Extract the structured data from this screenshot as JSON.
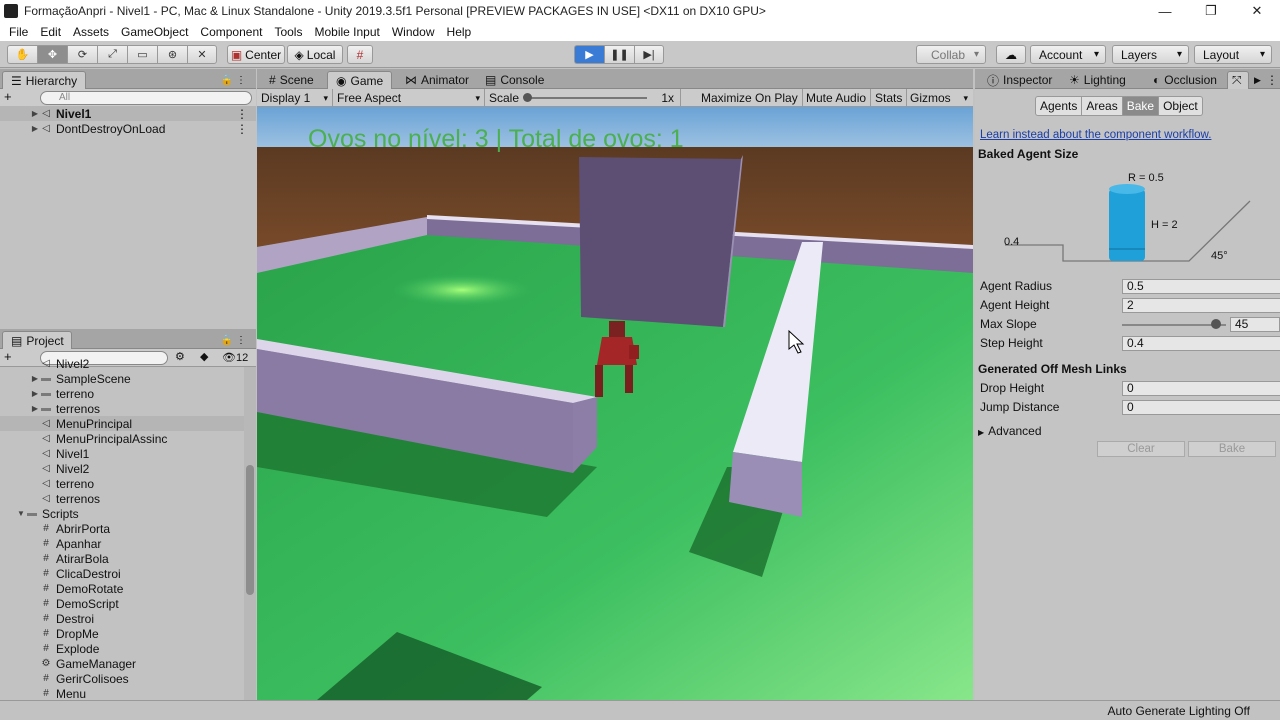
{
  "window": {
    "title": "FormaçãoAnpri - Nivel1 - PC, Mac & Linux Standalone - Unity 2019.3.5f1 Personal [PREVIEW PACKAGES IN USE] <DX11 on DX10 GPU>",
    "minimize": "—",
    "restore": "❐",
    "close": "✕"
  },
  "menu": [
    "File",
    "Edit",
    "Assets",
    "GameObject",
    "Component",
    "Tools",
    "Mobile Input",
    "Window",
    "Help"
  ],
  "toolbar": {
    "tools": [
      "✋",
      "✥",
      "⟳",
      "⤢",
      "▭",
      "⊛",
      "✕"
    ],
    "center": "Center",
    "local": "Local",
    "play": "▶",
    "pause": "❚❚",
    "step": "▶|",
    "collab": "Collab",
    "cloud": "☁",
    "account": "Account",
    "layers": "Layers",
    "layout": "Layout"
  },
  "hierarchy": {
    "tab": "Hierarchy",
    "add": "+",
    "search_placeholder": "All",
    "items": [
      "Nivel1",
      "DontDestroyOnLoad"
    ]
  },
  "project": {
    "tab": "Project",
    "add": "+",
    "count": "12",
    "items": [
      {
        "label": "Nivel2",
        "type": "scene"
      },
      {
        "label": "SampleScene",
        "type": "folder"
      },
      {
        "label": "terreno",
        "type": "folder"
      },
      {
        "label": "terrenos",
        "type": "folder"
      },
      {
        "label": "MenuPrincipal",
        "type": "scene"
      },
      {
        "label": "MenuPrincipalAssinc",
        "type": "scene"
      },
      {
        "label": "Nivel1",
        "type": "scene"
      },
      {
        "label": "Nivel2",
        "type": "scene"
      },
      {
        "label": "terreno",
        "type": "scene"
      },
      {
        "label": "terrenos",
        "type": "scene"
      },
      {
        "label": "Scripts",
        "type": "openfolder"
      },
      {
        "label": "AbrirPorta",
        "type": "script"
      },
      {
        "label": "Apanhar",
        "type": "script"
      },
      {
        "label": "AtirarBola",
        "type": "script"
      },
      {
        "label": "ClicaDestroi",
        "type": "script"
      },
      {
        "label": "DemoRotate",
        "type": "script"
      },
      {
        "label": "DemoScript",
        "type": "script"
      },
      {
        "label": "Destroi",
        "type": "script"
      },
      {
        "label": "DropMe",
        "type": "script"
      },
      {
        "label": "Explode",
        "type": "script"
      },
      {
        "label": "GameManager",
        "type": "gear"
      },
      {
        "label": "GerirColisoes",
        "type": "script"
      },
      {
        "label": "Menu",
        "type": "script"
      }
    ]
  },
  "center_tabs": [
    "Scene",
    "Game",
    "Animator",
    "Console"
  ],
  "game_bar": {
    "display": "Display 1",
    "aspect": "Free Aspect",
    "scale_label": "Scale",
    "scale_value": "1x",
    "maximize": "Maximize On Play",
    "mute": "Mute Audio",
    "stats": "Stats",
    "gizmos": "Gizmos"
  },
  "game_view": {
    "hud_text": "Ovos no nível: 3 | Total de ovos: 1",
    "hud_color": "#4caf50"
  },
  "right_tabs": [
    "Inspector",
    "Lighting",
    "Occlusion"
  ],
  "navigation": {
    "subtabs": [
      "Agents",
      "Areas",
      "Bake",
      "Object"
    ],
    "active_subtab": "Bake",
    "link": "Learn instead about the component workflow.",
    "baked_title": "Baked Agent Size",
    "diagram": {
      "r": "R = 0.5",
      "h": "H = 2",
      "step": "0.4",
      "angle": "45°"
    },
    "fields": [
      {
        "label": "Agent Radius",
        "value": "0.5"
      },
      {
        "label": "Agent Height",
        "value": "2"
      },
      {
        "label": "Max Slope",
        "value": "45",
        "slider": 0.9
      },
      {
        "label": "Step Height",
        "value": "0.4"
      }
    ],
    "offmesh_title": "Generated Off Mesh Links",
    "offmesh_fields": [
      {
        "label": "Drop Height",
        "value": "0"
      },
      {
        "label": "Jump Distance",
        "value": "0"
      }
    ],
    "advanced": "Advanced",
    "clear": "Clear",
    "bake": "Bake"
  },
  "status": {
    "right": "Auto Generate Lighting Off"
  }
}
